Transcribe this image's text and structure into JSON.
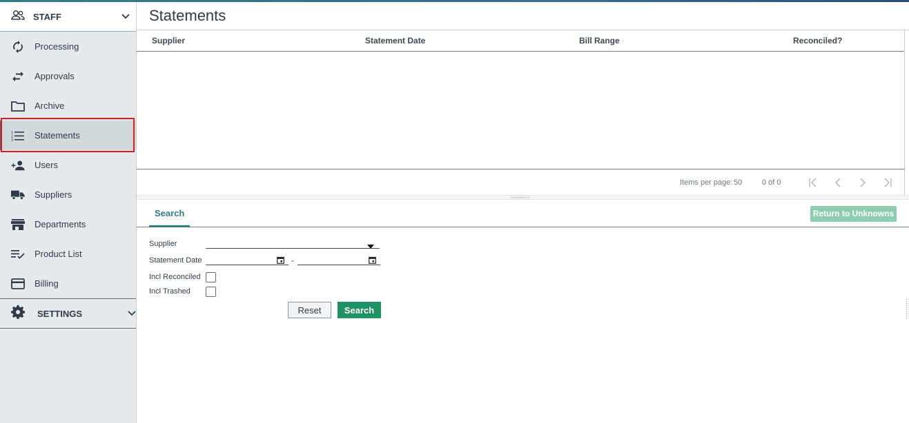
{
  "sidebar": {
    "staff_group": {
      "label": "STAFF",
      "icon": "people-icon"
    },
    "items": [
      {
        "label": "Processing",
        "icon": "sync-icon"
      },
      {
        "label": "Approvals",
        "icon": "swap-arrows-icon"
      },
      {
        "label": "Archive",
        "icon": "folder-icon"
      },
      {
        "label": "Statements",
        "icon": "numbered-list-icon",
        "active": true
      },
      {
        "label": "Users",
        "icon": "add-user-icon"
      },
      {
        "label": "Suppliers",
        "icon": "truck-icon"
      },
      {
        "label": "Departments",
        "icon": "store-icon"
      },
      {
        "label": "Product List",
        "icon": "checklist-icon"
      },
      {
        "label": "Billing",
        "icon": "credit-card-icon"
      }
    ],
    "settings_group": {
      "label": "SETTINGS",
      "icon": "gear-icon"
    }
  },
  "main": {
    "title": "Statements",
    "grid": {
      "columns": [
        "Supplier",
        "Statement Date",
        "Bill Range",
        "Reconciled?"
      ],
      "rows": []
    },
    "pager": {
      "items_per_page_label": "Items per page:",
      "items_per_page": "50",
      "range": "0 of 0"
    },
    "tabs": [
      {
        "label": "Search"
      }
    ],
    "return_button": "Return to Unknowns",
    "form": {
      "supplier_label": "Supplier",
      "supplier_value": "",
      "statement_date_label": "Statement Date",
      "date_from": "",
      "date_to": "",
      "date_separator": "-",
      "incl_reconciled_label": "Incl Reconciled",
      "incl_reconciled": false,
      "incl_trashed_label": "Incl Trashed",
      "incl_trashed": false,
      "reset_button": "Reset",
      "search_button": "Search"
    }
  },
  "colors": {
    "accent": "#2f7d80",
    "primary_button": "#1f9164",
    "disabled_button": "#8fcdb1",
    "highlight": "#e01b1b"
  }
}
